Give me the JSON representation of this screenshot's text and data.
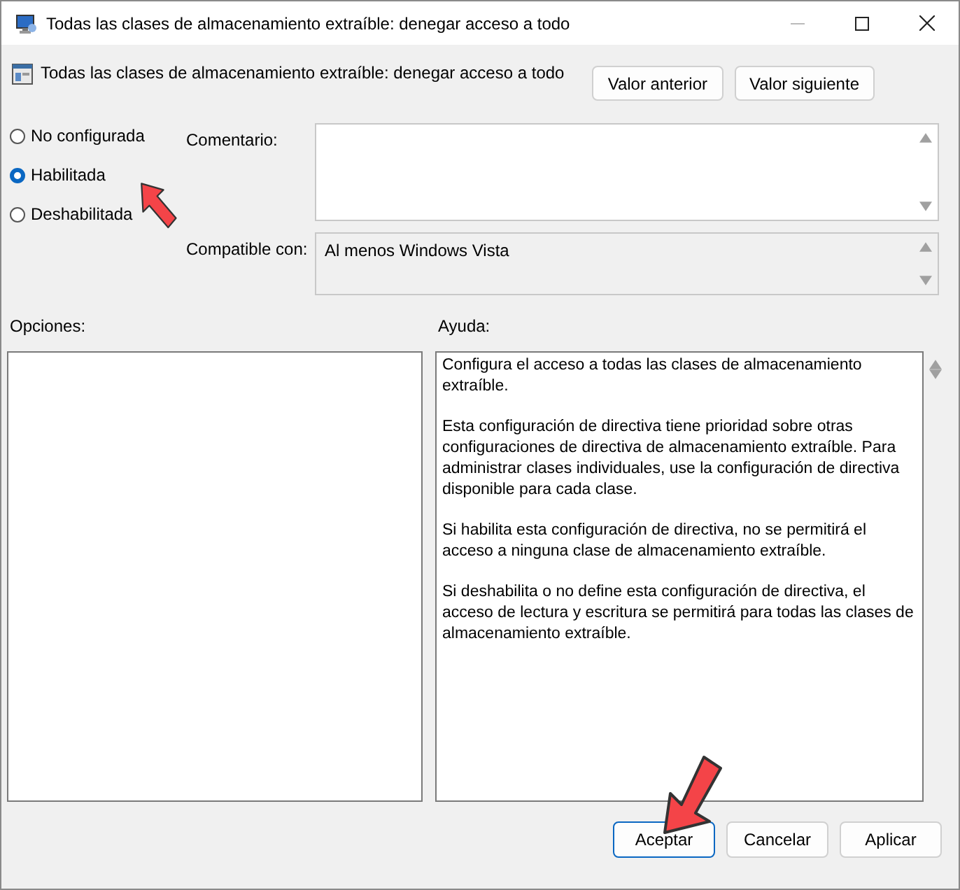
{
  "window": {
    "title": "Todas las clases de almacenamiento extraíble: denegar acceso a todo"
  },
  "header": {
    "title": "Todas las clases de almacenamiento extraíble: denegar acceso a todo",
    "buttons": [
      "Valor anterior",
      "Valor siguiente"
    ]
  },
  "states": [
    {
      "label": "No configurada",
      "selected": false
    },
    {
      "label": "Habilitada",
      "selected": true
    },
    {
      "label": "Deshabilitada",
      "selected": false
    }
  ],
  "comment": {
    "label": "Comentario:"
  },
  "compatible": {
    "label": "Compatible con:",
    "value": "Al menos Windows Vista"
  },
  "options": {
    "label": "Opciones:"
  },
  "help": {
    "label": "Ayuda:",
    "paragraphs": [
      "Configura el acceso a todas las clases de almacenamiento extraíble.",
      "Esta configuración de directiva tiene prioridad sobre otras configuraciones de directiva de almacenamiento extraíble. Para administrar clases individuales, use la configuración de directiva disponible para cada clase.",
      "Si habilita esta configuración de directiva, no se permitirá el acceso a ninguna clase de almacenamiento extraíble.",
      "Si deshabilita o no define esta configuración de directiva, el acceso de lectura y escritura se permitirá para todas las clases de almacenamiento extraíble."
    ]
  },
  "footer_buttons": [
    {
      "label": "Aceptar",
      "kind": "default"
    },
    {
      "label": "Cancelar",
      "kind": "normal"
    },
    {
      "label": "Aplicar",
      "kind": "normal"
    }
  ]
}
